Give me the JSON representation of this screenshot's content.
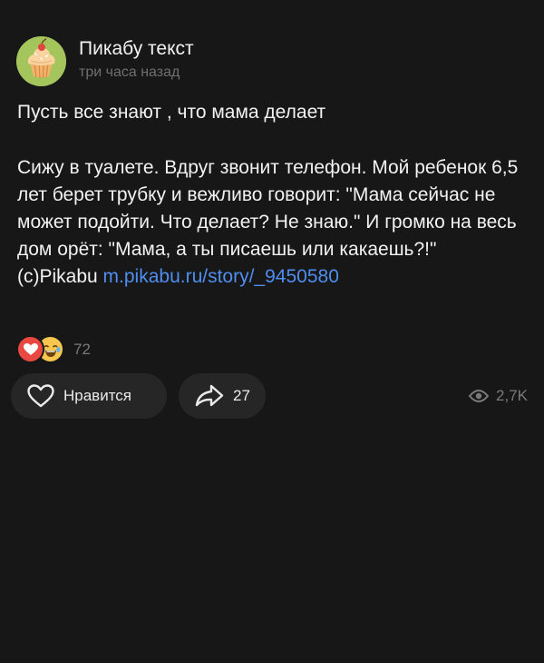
{
  "channel": {
    "name": "Пикабу текст",
    "time": "три часа назад"
  },
  "post": {
    "title": "Пусть все знают , что мама делает",
    "body": "Сижу в туалете. Вдруг звонит телефон. Мой ребенок 6,5 лет берет трубку и вежливо говорит: \"Мама сейчас не может подойти. Что делает? Не знаю.\" И громко на весь дом орёт: \"Мама, а ты писаешь или какаешь?!\"",
    "source_prefix": "(c)Pikabu",
    "source_link": "m.pikabu.ru/story/_9450580"
  },
  "reactions": {
    "emojis": [
      "heart",
      "laughing-tears"
    ],
    "count": "72"
  },
  "actions": {
    "like_label": "Нравится",
    "share_count": "27",
    "views_count": "2,7K"
  },
  "colors": {
    "background": "#171717",
    "button_bg": "#262626",
    "link": "#4f8ef0",
    "muted_text": "#7a7a7a"
  }
}
